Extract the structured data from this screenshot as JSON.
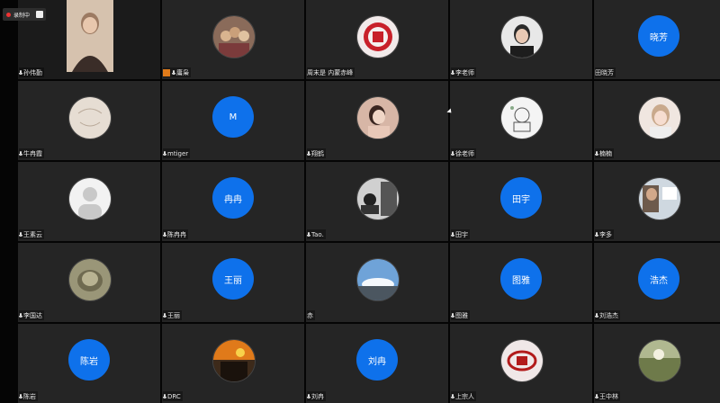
{
  "meeting": {
    "recording_label": "录制中",
    "colors": {
      "background": "#050505",
      "tile": "#252525",
      "avatar_blue": "#0e71eb",
      "muted": "#e33333"
    }
  },
  "participants": [
    {
      "name": "孙伟勤",
      "type": "video",
      "mic": "on"
    },
    {
      "name": "庸枭",
      "type": "photo",
      "mic": "on",
      "host": true
    },
    {
      "name": "周末是 内蒙赤峰",
      "type": "photo",
      "mic": "none"
    },
    {
      "name": "李老师",
      "type": "photo",
      "mic": "on"
    },
    {
      "name": "田晓芳",
      "type": "text",
      "initials": "晓芳",
      "mic": "none"
    },
    {
      "name": "牛冉霞",
      "type": "photo",
      "mic": "on"
    },
    {
      "name": "mtiger",
      "type": "text",
      "initials": "M",
      "mic": "on"
    },
    {
      "name": "翔鹤",
      "type": "photo",
      "mic": "on"
    },
    {
      "name": "徐老师",
      "type": "photo",
      "mic": "on"
    },
    {
      "name": "楠楠",
      "type": "photo",
      "mic": "on"
    },
    {
      "name": "王素云",
      "type": "photo",
      "mic": "on"
    },
    {
      "name": "陈冉冉",
      "type": "text",
      "initials": "冉冉",
      "mic": "on"
    },
    {
      "name": "Tao.",
      "type": "photo",
      "mic": "on"
    },
    {
      "name": "田宇",
      "type": "text",
      "initials": "田宇",
      "mic": "on"
    },
    {
      "name": "李多",
      "type": "photo",
      "mic": "on"
    },
    {
      "name": "李国达",
      "type": "photo",
      "mic": "active"
    },
    {
      "name": "王丽",
      "type": "text",
      "initials": "王丽",
      "mic": "on"
    },
    {
      "name": "赤",
      "type": "photo",
      "mic": "none"
    },
    {
      "name": "图雅",
      "type": "text",
      "initials": "图雅",
      "mic": "on"
    },
    {
      "name": "刘浩杰",
      "type": "text",
      "initials": "浩杰",
      "mic": "on"
    },
    {
      "name": "陈岩",
      "type": "text",
      "initials": "陈岩",
      "mic": "on"
    },
    {
      "name": "DRC",
      "type": "photo",
      "mic": "on"
    },
    {
      "name": "刘冉",
      "type": "text",
      "initials": "刘冉",
      "mic": "on"
    },
    {
      "name": "上宗人",
      "type": "photo",
      "mic": "on"
    },
    {
      "name": "王中林",
      "type": "photo",
      "mic": "on"
    }
  ]
}
